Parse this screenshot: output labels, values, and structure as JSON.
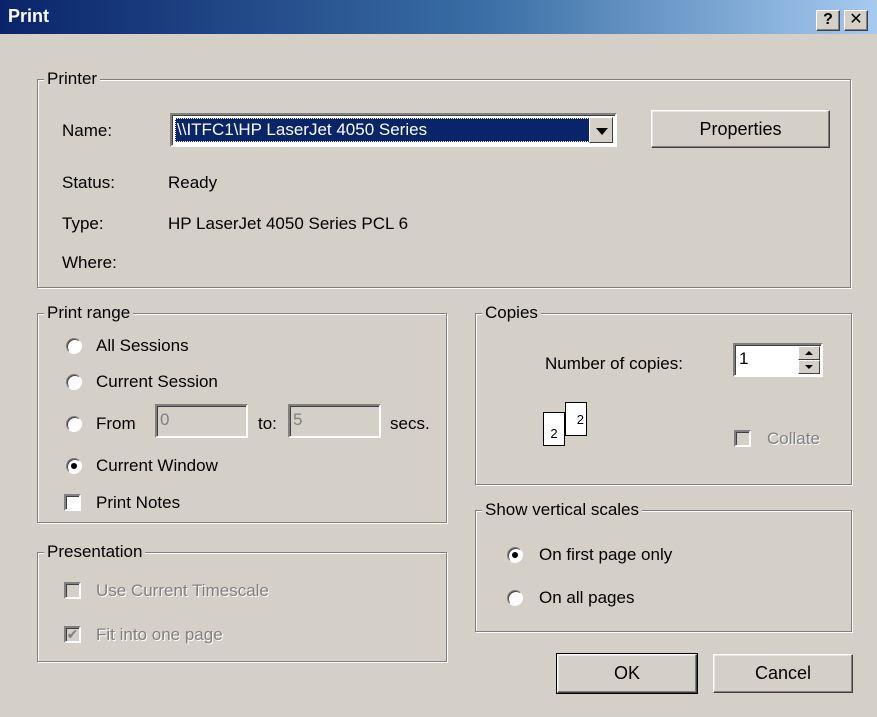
{
  "window": {
    "title": "Print",
    "help_glyph": "?",
    "close_glyph": "✕"
  },
  "printer": {
    "legend": "Printer",
    "name_label": "Name:",
    "name_value": "\\\\ITFC1\\HP LaserJet 4050 Series",
    "properties_label": "Properties",
    "status_label": "Status:",
    "status_value": "Ready",
    "type_label": "Type:",
    "type_value": "HP LaserJet 4050 Series PCL 6",
    "where_label": "Where:",
    "where_value": ""
  },
  "print_range": {
    "legend": "Print range",
    "options": [
      {
        "label": "All Sessions",
        "checked": false
      },
      {
        "label": "Current Session",
        "checked": false
      },
      {
        "label": "From",
        "checked": false
      },
      {
        "label": "Current Window",
        "checked": true
      }
    ],
    "from_value": "0",
    "to_label": "to:",
    "to_value": "5",
    "secs_label": "secs.",
    "print_notes_label": "Print Notes",
    "print_notes_checked": false
  },
  "presentation": {
    "legend": "Presentation",
    "use_timescale_label": "Use Current Timescale",
    "use_timescale_checked": false,
    "fit_page_label": "Fit into one page",
    "fit_page_checked": true
  },
  "copies": {
    "legend": "Copies",
    "number_label": "Number of copies:",
    "number_value": "1",
    "page_front": "2",
    "page_back": "2",
    "collate_label": "Collate",
    "collate_checked": false
  },
  "vertical_scales": {
    "legend": "Show vertical scales",
    "first_page_label": "On first page only",
    "all_pages_label": "On all pages",
    "selected": "first_page"
  },
  "buttons": {
    "ok_label": "OK",
    "cancel_label": "Cancel"
  }
}
